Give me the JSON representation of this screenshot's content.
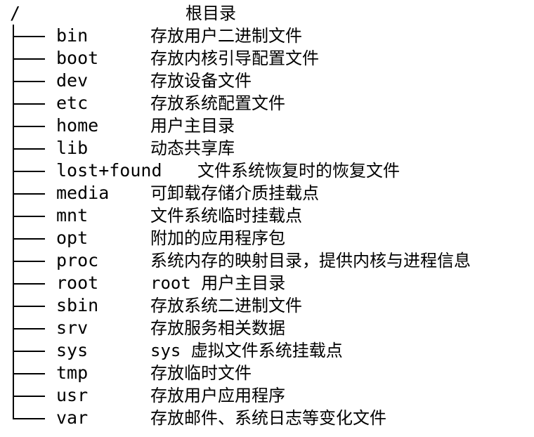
{
  "root": {
    "symbol": "/",
    "description": "根目录"
  },
  "entries": [
    {
      "name": "bin",
      "description": "存放用户二进制文件"
    },
    {
      "name": "boot",
      "description": "存放内核引导配置文件"
    },
    {
      "name": "dev",
      "description": "存放设备文件"
    },
    {
      "name": "etc",
      "description": "存放系统配置文件"
    },
    {
      "name": "home",
      "description": "用户主目录"
    },
    {
      "name": "lib",
      "description": "动态共享库"
    },
    {
      "name": "lost+found",
      "description": "文件系统恢复时的恢复文件"
    },
    {
      "name": "media",
      "description": "可卸载存储介质挂载点"
    },
    {
      "name": "mnt",
      "description": "文件系统临时挂载点"
    },
    {
      "name": "opt",
      "description": "附加的应用程序包"
    },
    {
      "name": "proc",
      "description": "系统内存的映射目录，提供内核与进程信息"
    },
    {
      "name": "root",
      "description": "root 用户主目录"
    },
    {
      "name": "sbin",
      "description": "存放系统二进制文件"
    },
    {
      "name": "srv",
      "description": "存放服务相关数据"
    },
    {
      "name": "sys",
      "description": "sys 虚拟文件系统挂载点"
    },
    {
      "name": "tmp",
      "description": "存放临时文件"
    },
    {
      "name": "usr",
      "description": "存放用户应用程序"
    },
    {
      "name": "var",
      "description": "存放邮件、系统日志等变化文件"
    }
  ]
}
